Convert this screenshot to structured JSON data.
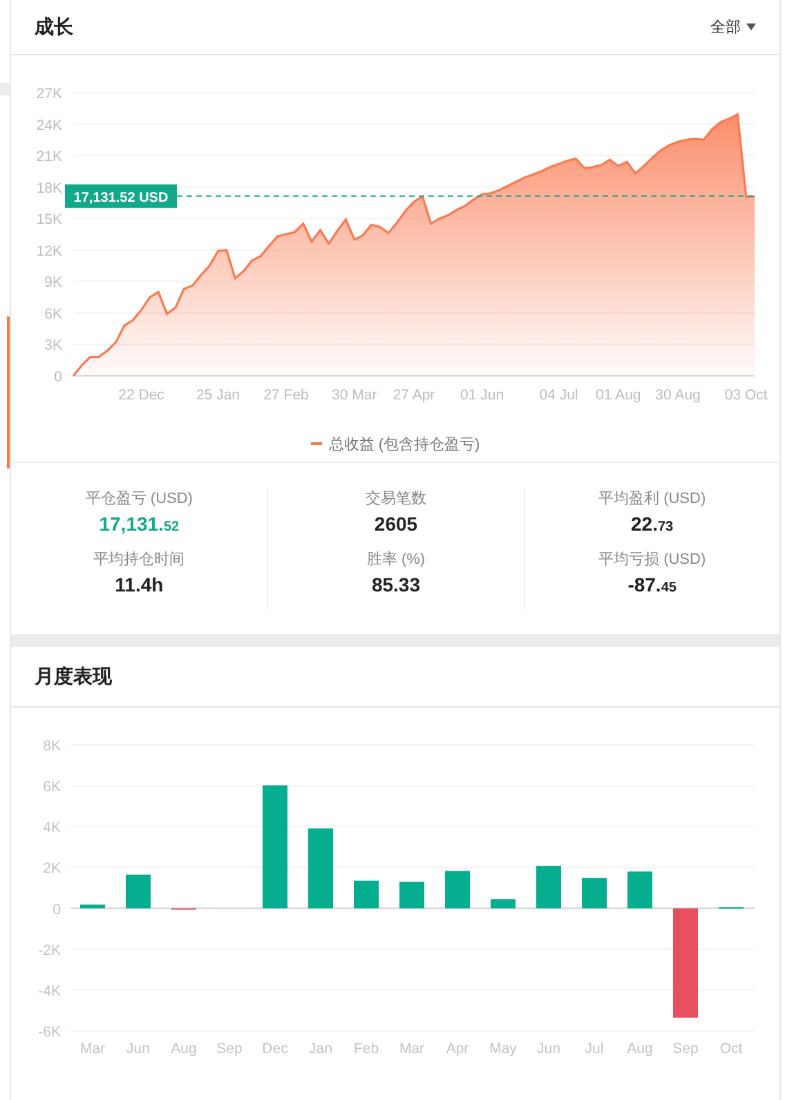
{
  "growth": {
    "title": "成长",
    "filter": "全部",
    "chart_data": {
      "type": "area",
      "grid": true,
      "ylim": [
        0,
        27000
      ],
      "yticks": [
        {
          "value": 0,
          "label": "0"
        },
        {
          "value": 3000,
          "label": "3K"
        },
        {
          "value": 6000,
          "label": "6K"
        },
        {
          "value": 9000,
          "label": "9K"
        },
        {
          "value": 12000,
          "label": "12K"
        },
        {
          "value": 15000,
          "label": "15K"
        },
        {
          "value": 18000,
          "label": "18K"
        },
        {
          "value": 21000,
          "label": "21K"
        },
        {
          "value": 24000,
          "label": "24K"
        },
        {
          "value": 27000,
          "label": "27K"
        }
      ],
      "categories": [
        null,
        null,
        null,
        null,
        null,
        null,
        null,
        null,
        "22 Dec",
        null,
        null,
        null,
        null,
        null,
        null,
        null,
        null,
        "25 Jan",
        null,
        null,
        null,
        null,
        null,
        null,
        null,
        "27 Feb",
        null,
        null,
        null,
        null,
        null,
        null,
        null,
        "30 Mar",
        null,
        null,
        null,
        null,
        null,
        null,
        "27 Apr",
        null,
        null,
        null,
        null,
        null,
        null,
        null,
        "01 Jun",
        null,
        null,
        null,
        null,
        null,
        null,
        null,
        null,
        "04 Jul",
        null,
        null,
        null,
        null,
        null,
        null,
        "01 Aug",
        null,
        null,
        null,
        null,
        null,
        null,
        "30 Aug",
        null,
        null,
        null,
        null,
        null,
        null,
        null,
        "03 Oct",
        null
      ],
      "series": [
        {
          "name": "总收益 (包含持仓盈亏)",
          "color": "#fa7a52",
          "values": [
            0,
            1000,
            1800,
            1800,
            2400,
            3200,
            4800,
            5300,
            6300,
            7500,
            8000,
            5900,
            6500,
            8300,
            8600,
            9600,
            10500,
            11900,
            12000,
            9300,
            10000,
            11000,
            11400,
            12400,
            13300,
            13500,
            13700,
            14500,
            12800,
            13900,
            12600,
            13800,
            14900,
            13000,
            13400,
            14400,
            14200,
            13600,
            14600,
            15700,
            16600,
            17100,
            14500,
            15000,
            15300,
            15800,
            16200,
            16800,
            17300,
            17400,
            17700,
            18100,
            18500,
            18900,
            19200,
            19500,
            19900,
            20200,
            20500,
            20700,
            19800,
            19900,
            20100,
            20600,
            20000,
            20400,
            19300,
            20000,
            20800,
            21500,
            22000,
            22300,
            22500,
            22600,
            22500,
            23500,
            24200,
            24500,
            24900,
            17100,
            17100
          ]
        }
      ],
      "ref_lines": [
        {
          "axis": "y",
          "value": 17131.52,
          "label": "17,131.52 USD"
        }
      ]
    }
  },
  "stats": [
    {
      "label": "平仓盈亏 (USD)",
      "value": "17,131.",
      "fraction": "52",
      "highlight": true
    },
    {
      "label": "交易笔数",
      "value": "2605",
      "highlight": false
    },
    {
      "label": "平均盈利 (USD)",
      "value": "22.",
      "fraction": "73",
      "highlight": false
    },
    {
      "label": "平均持仓时间",
      "value": "11.4h",
      "highlight": false
    },
    {
      "label": "胜率 (%)",
      "value": "85.33",
      "highlight": false
    },
    {
      "label": "平均亏损 (USD)",
      "value": "-87.",
      "fraction": "45",
      "highlight": false
    }
  ],
  "monthly": {
    "title": "月度表现",
    "chart_data": {
      "type": "bar",
      "stacked": true,
      "grid": true,
      "ylim": [
        -6000,
        8000
      ],
      "yticks": [
        {
          "value": -6000,
          "label": "-6K"
        },
        {
          "value": -4000,
          "label": "-4K"
        },
        {
          "value": -2000,
          "label": "-2K"
        },
        {
          "value": 0,
          "label": "0"
        },
        {
          "value": 2000,
          "label": "2K"
        },
        {
          "value": 4000,
          "label": "4K"
        },
        {
          "value": 6000,
          "label": "6K"
        },
        {
          "value": 8000,
          "label": "8K"
        }
      ],
      "categories": [
        "Mar",
        "Jun",
        "Aug",
        "Sep",
        "Dec",
        "Jan",
        "Feb",
        "Mar",
        "Apr",
        "May",
        "Jun",
        "Jul",
        "Aug",
        "Sep",
        "Oct"
      ],
      "series": [
        {
          "color": "#04ae8f",
          "values": [
            180,
            1650,
            null,
            null,
            6020,
            3910,
            1350,
            1300,
            1830,
            450,
            2080,
            1480,
            1800,
            null,
            50
          ]
        },
        {
          "color": "#e8505f",
          "values": [
            null,
            null,
            -30,
            null,
            null,
            null,
            null,
            null,
            null,
            null,
            null,
            null,
            null,
            -5350,
            null
          ]
        }
      ]
    }
  }
}
